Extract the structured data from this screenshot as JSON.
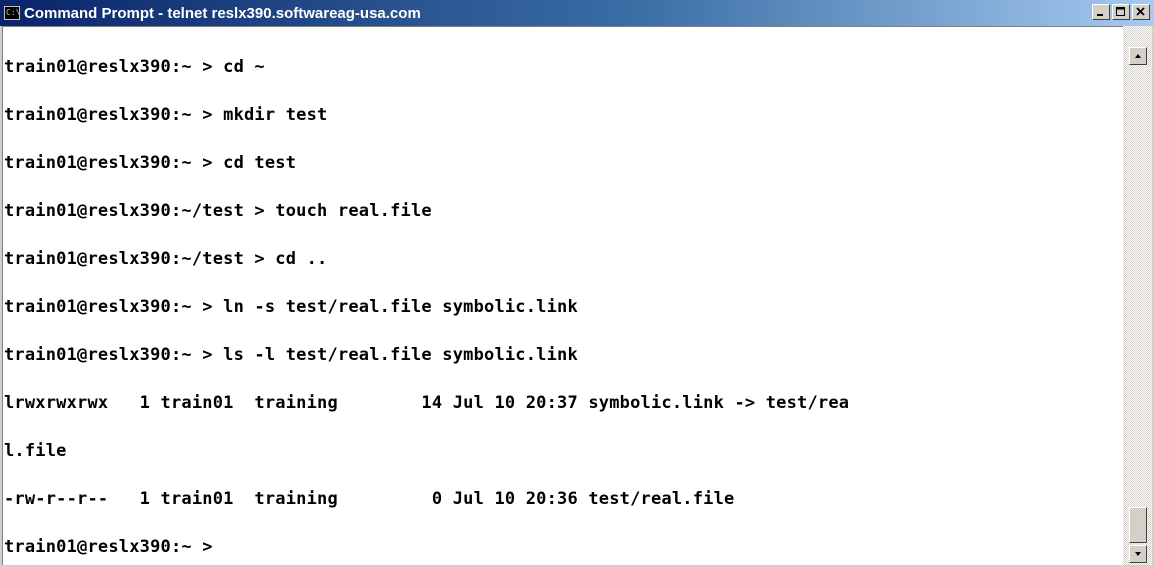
{
  "window": {
    "title": "Command Prompt - telnet reslx390.softwareag-usa.com",
    "icon_label": "C:\\",
    "icon": "console-icon",
    "buttons": [
      "minimize-icon",
      "maximize-icon",
      "close-icon"
    ]
  },
  "colors": {
    "titlebar_start": "#0a246a",
    "titlebar_end": "#a6caf0",
    "terminal_bg": "#ffffff",
    "terminal_text": "#000000",
    "chrome": "#d4d0c8"
  },
  "terminal": {
    "lines": [
      "train01@reslx390:~ > cd ~",
      "train01@reslx390:~ > mkdir test",
      "train01@reslx390:~ > cd test",
      "train01@reslx390:~/test > touch real.file",
      "train01@reslx390:~/test > cd ..",
      "train01@reslx390:~ > ln -s test/real.file symbolic.link",
      "train01@reslx390:~ > ls -l test/real.file symbolic.link",
      "lrwxrwxrwx   1 train01  training        14 Jul 10 20:37 symbolic.link -> test/rea",
      "l.file",
      "-rw-r--r--   1 train01  training         0 Jul 10 20:36 test/real.file",
      "train01@reslx390:~ >"
    ]
  },
  "scrollbar": {
    "up_icon": "arrow-up-icon",
    "down_icon": "arrow-down-icon"
  }
}
